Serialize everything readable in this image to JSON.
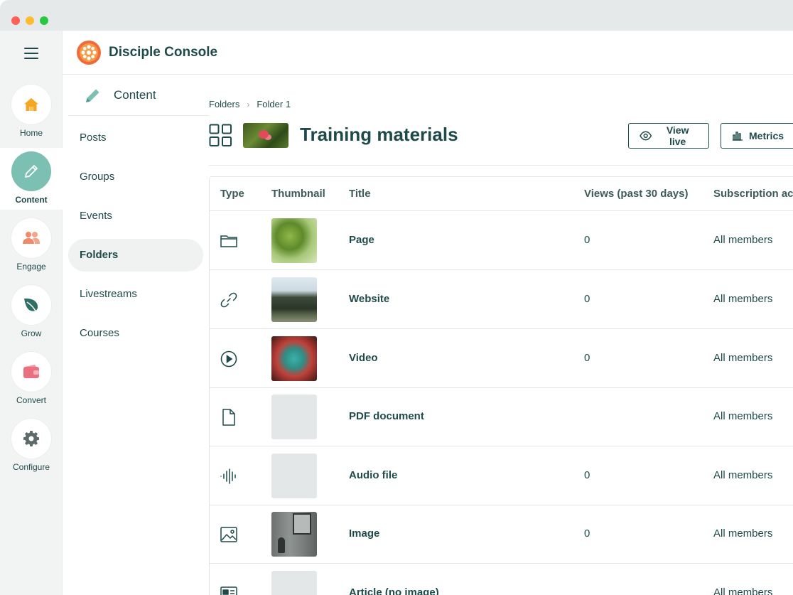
{
  "app": {
    "title": "Disciple Console"
  },
  "rail": {
    "items": [
      {
        "label": "Home",
        "icon": "home-icon",
        "color": "#f5a623"
      },
      {
        "label": "Content",
        "icon": "pencil-icon",
        "color": "#ffffff"
      },
      {
        "label": "Engage",
        "icon": "people-icon",
        "color": "#ef8b6b"
      },
      {
        "label": "Grow",
        "icon": "leaf-icon",
        "color": "#2f6f63"
      },
      {
        "label": "Convert",
        "icon": "wallet-icon",
        "color": "#e9707e"
      },
      {
        "label": "Configure",
        "icon": "gear-icon",
        "color": "#5d6b6b"
      }
    ],
    "active": "Content"
  },
  "subnav": {
    "title": "Content",
    "items": [
      "Posts",
      "Groups",
      "Events",
      "Folders",
      "Livestreams",
      "Courses"
    ],
    "active": "Folders"
  },
  "breadcrumb": {
    "items": [
      "Folders",
      "Folder 1"
    ]
  },
  "header": {
    "title": "Training materials",
    "view_live": "View live",
    "metrics": "Metrics"
  },
  "table": {
    "columns": [
      "Type",
      "Thumbnail",
      "Title",
      "Views (past 30 days)",
      "Subscription ac"
    ],
    "rows": [
      {
        "type_icon": "folder-icon",
        "thumb": "leaf-photo",
        "title": "Page",
        "views": "0",
        "access": "All members"
      },
      {
        "type_icon": "link-icon",
        "thumb": "tree-photo",
        "title": "Website",
        "views": "0",
        "access": "All members"
      },
      {
        "type_icon": "play-icon",
        "thumb": "art-photo",
        "title": "Video",
        "views": "0",
        "access": "All members"
      },
      {
        "type_icon": "file-icon",
        "thumb": "placeholder",
        "title": "PDF document",
        "views": "",
        "access": "All members"
      },
      {
        "type_icon": "audio-icon",
        "thumb": "placeholder",
        "title": "Audio file",
        "views": "0",
        "access": "All members"
      },
      {
        "type_icon": "image-icon",
        "thumb": "wall-photo",
        "title": "Image",
        "views": "0",
        "access": "All members"
      },
      {
        "type_icon": "article-icon",
        "thumb": "placeholder",
        "title": "Article (no image)",
        "views": "",
        "access": "All members"
      }
    ]
  },
  "colors": {
    "primary": "#1f4a4a",
    "accent": "#7bc0b2",
    "logo": "#f06a3c"
  }
}
